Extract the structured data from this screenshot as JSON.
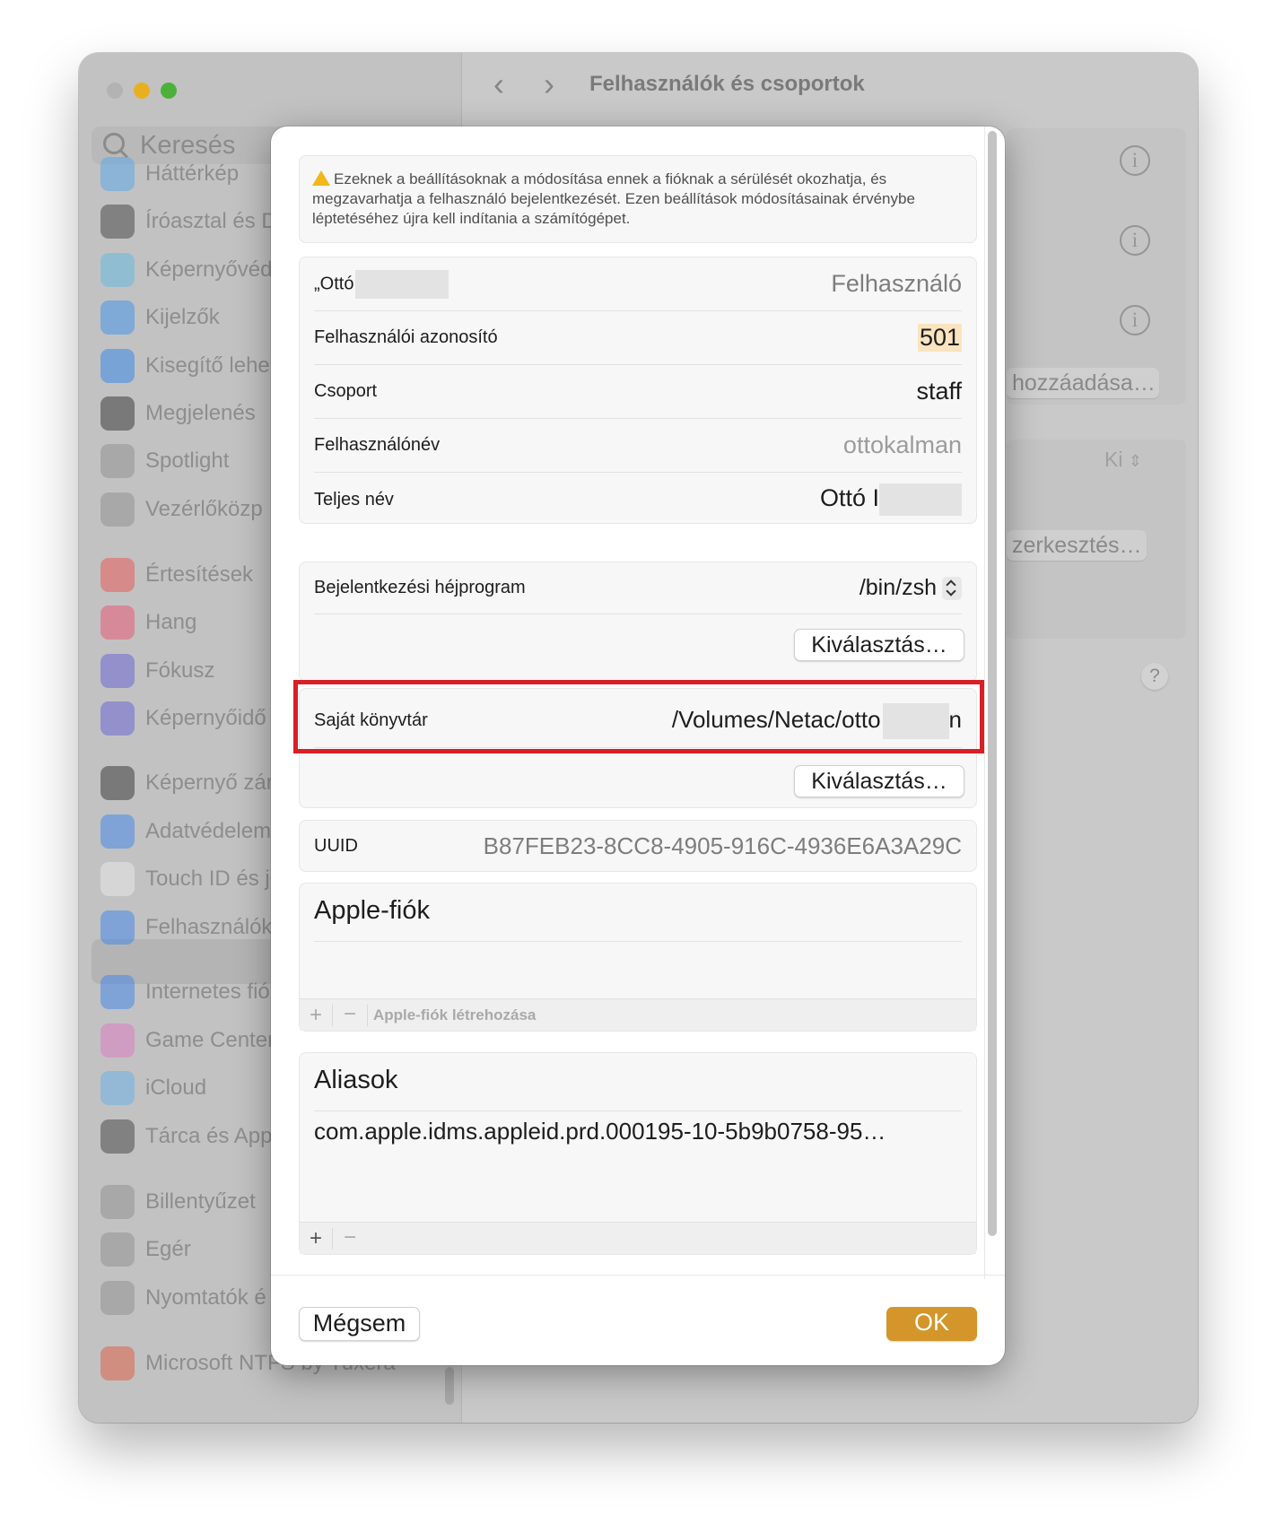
{
  "window": {
    "title": "Felhasználók és csoportok"
  },
  "sidebar": {
    "search_placeholder": "Keresés",
    "items": [
      {
        "label": "Háttérkép",
        "icon": "flower-icon",
        "color": "#4aa5f0"
      },
      {
        "label": "Íróasztal és D",
        "icon": "desktop-icon",
        "color": "#333333"
      },
      {
        "label": "Képernyővéd",
        "icon": "screensaver-icon",
        "color": "#56b8e6"
      },
      {
        "label": "Kijelzők",
        "icon": "sun-icon",
        "color": "#2f8cf0"
      },
      {
        "label": "Kisegítő lehe",
        "icon": "accessibility-icon",
        "color": "#1e7ff0"
      },
      {
        "label": "Megjelenés",
        "icon": "appearance-icon",
        "color": "#222222"
      },
      {
        "label": "Spotlight",
        "icon": "magnifier-icon",
        "color": "#8a8a8a"
      },
      {
        "label": "Vezérlőközp",
        "icon": "toggles-icon",
        "color": "#8a8a8a"
      },
      {
        "label": "Értesítések",
        "icon": "bell-icon",
        "color": "#f04848"
      },
      {
        "label": "Hang",
        "icon": "speaker-icon",
        "color": "#f04868"
      },
      {
        "label": "Fókusz",
        "icon": "moon-icon",
        "color": "#5b55d6"
      },
      {
        "label": "Képernyőidő",
        "icon": "hourglass-icon",
        "color": "#5b55d6"
      },
      {
        "label": "Képernyő zár",
        "icon": "lock-icon",
        "color": "#222222"
      },
      {
        "label": "Adatvédelem",
        "icon": "hand-icon",
        "color": "#2f7ff0"
      },
      {
        "label": "Touch ID és j",
        "icon": "fingerprint-icon",
        "color": "#f0f0f0"
      },
      {
        "label": "Felhasználók",
        "icon": "users-icon",
        "color": "#2f7ff0"
      },
      {
        "label": "Internetes fió",
        "icon": "at-icon",
        "color": "#2f7ff0"
      },
      {
        "label": "Game Center",
        "icon": "gamecenter-icon",
        "color": "#e070c0"
      },
      {
        "label": "iCloud",
        "icon": "cloud-icon",
        "color": "#5ab0f0"
      },
      {
        "label": "Tárca és App",
        "icon": "wallet-icon",
        "color": "#333333"
      },
      {
        "label": "Billentyűzet",
        "icon": "keyboard-icon",
        "color": "#8a8a8a"
      },
      {
        "label": "Egér",
        "icon": "mouse-icon",
        "color": "#8a8a8a"
      },
      {
        "label": "Nyomtatók é",
        "icon": "printer-icon",
        "color": "#8a8a8a"
      },
      {
        "label": "Microsoft NTFS by Tuxera",
        "icon": "tuxera-icon",
        "color": "#e05030"
      }
    ]
  },
  "right_panel": {
    "add_button": "hozzáadása…",
    "popup_value": "Ki",
    "edit_button": "zerkesztés…",
    "help": "?"
  },
  "sheet": {
    "warning": "Ezeknek a beállításoknak a módosítása ennek a fióknak a sérülését okozhatja, és megzavarhatja a felhasználó bejelentkezését. Ezen beállítások módosításainak érvénybe léptetéséhez újra kell indítania a számítógépet.",
    "user": {
      "name_prefix": "„Ottó",
      "role": "Felhasználó",
      "uid_label": "Felhasználói azonosító",
      "uid_value": "501",
      "group_label": "Csoport",
      "group_value": "staff",
      "username_label": "Felhasználónév",
      "username_value": "ottokalman",
      "fullname_label": "Teljes név",
      "fullname_value": "Ottó I"
    },
    "shell": {
      "label": "Bejelentkezési héjprogram",
      "value": "/bin/zsh",
      "choose": "Kiválasztás…"
    },
    "home": {
      "label": "Saját könyvtár",
      "value": "/Volumes/Netac/otto",
      "suffix": "n",
      "choose": "Kiválasztás…"
    },
    "uuid": {
      "label": "UUID",
      "value": "B87FEB23-8CC8-4905-916C-4936E6A3A29C"
    },
    "apple_account": {
      "title": "Apple-fiók",
      "create": "Apple-fiók létrehozása"
    },
    "aliases": {
      "title": "Aliasok",
      "items": [
        "com.apple.idms.appleid.prd.000195-10-5b9b0758-95…"
      ]
    },
    "toolbar": {
      "plus": "+",
      "minus": "−"
    },
    "cancel": "Mégsem",
    "ok": "OK"
  },
  "colors": {
    "accent": "#d4962a",
    "highlight_box": "#d91f26",
    "uid_highlight": "#f9e4bf"
  }
}
